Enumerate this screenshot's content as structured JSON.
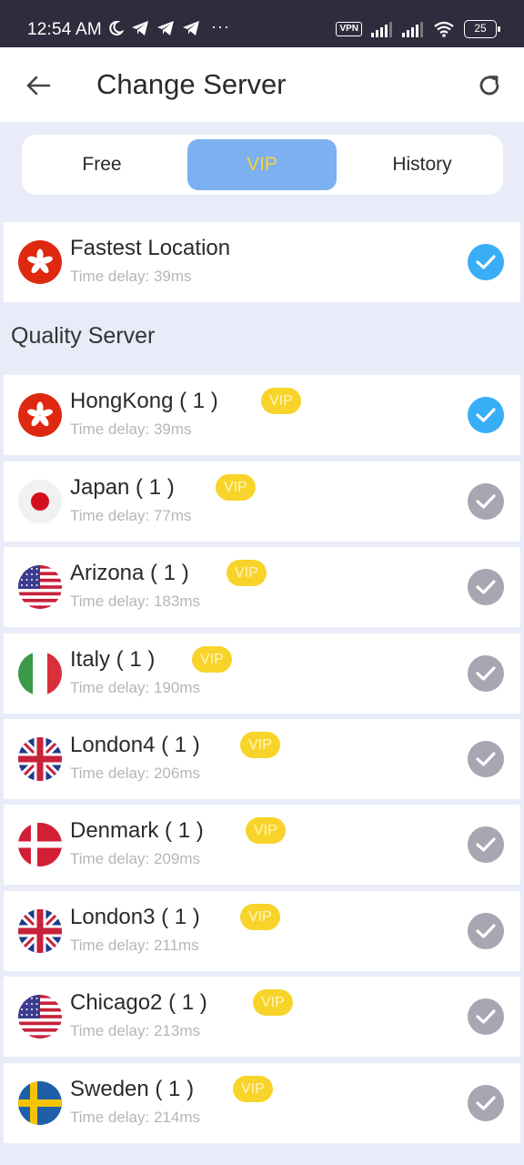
{
  "status_bar": {
    "time": "12:54 AM",
    "dots": "···",
    "vpn": "VPN",
    "battery": "25"
  },
  "header": {
    "title": "Change Server",
    "back_icon": "arrow-left-icon",
    "refresh_icon": "refresh-icon"
  },
  "tabs": [
    {
      "label": "Free",
      "selected": false
    },
    {
      "label": "VIP",
      "selected": true
    },
    {
      "label": "History",
      "selected": false
    }
  ],
  "fastest": {
    "name": "Fastest Location",
    "delay": "Time delay: 39ms",
    "flag": "hongkong",
    "checked": true
  },
  "section_title": "Quality Server",
  "vip_label": "VIP",
  "servers": [
    {
      "name": "HongKong ( 1 )",
      "delay": "Time delay: 39ms",
      "flag": "hongkong",
      "checked": true
    },
    {
      "name": "Japan ( 1 )",
      "delay": "Time delay: 77ms",
      "flag": "japan",
      "checked": false
    },
    {
      "name": "Arizona ( 1 )",
      "delay": "Time delay: 183ms",
      "flag": "usa",
      "checked": false
    },
    {
      "name": "Italy ( 1 )",
      "delay": "Time delay: 190ms",
      "flag": "italy",
      "checked": false
    },
    {
      "name": "London4 ( 1 )",
      "delay": "Time delay: 206ms",
      "flag": "uk",
      "checked": false
    },
    {
      "name": "Denmark ( 1 )",
      "delay": "Time delay: 209ms",
      "flag": "denmark",
      "checked": false
    },
    {
      "name": "London3 ( 1 )",
      "delay": "Time delay: 211ms",
      "flag": "uk",
      "checked": false
    },
    {
      "name": "Chicago2 ( 1 )",
      "delay": "Time delay: 213ms",
      "flag": "usa",
      "checked": false
    },
    {
      "name": "Sweden ( 1 )",
      "delay": "Time delay: 214ms",
      "flag": "sweden",
      "checked": false
    }
  ],
  "colors": {
    "accent": "#7db0f0",
    "vip_badge": "#f8d42b",
    "check_on": "#38aef7",
    "check_off": "#a7a7b3"
  }
}
